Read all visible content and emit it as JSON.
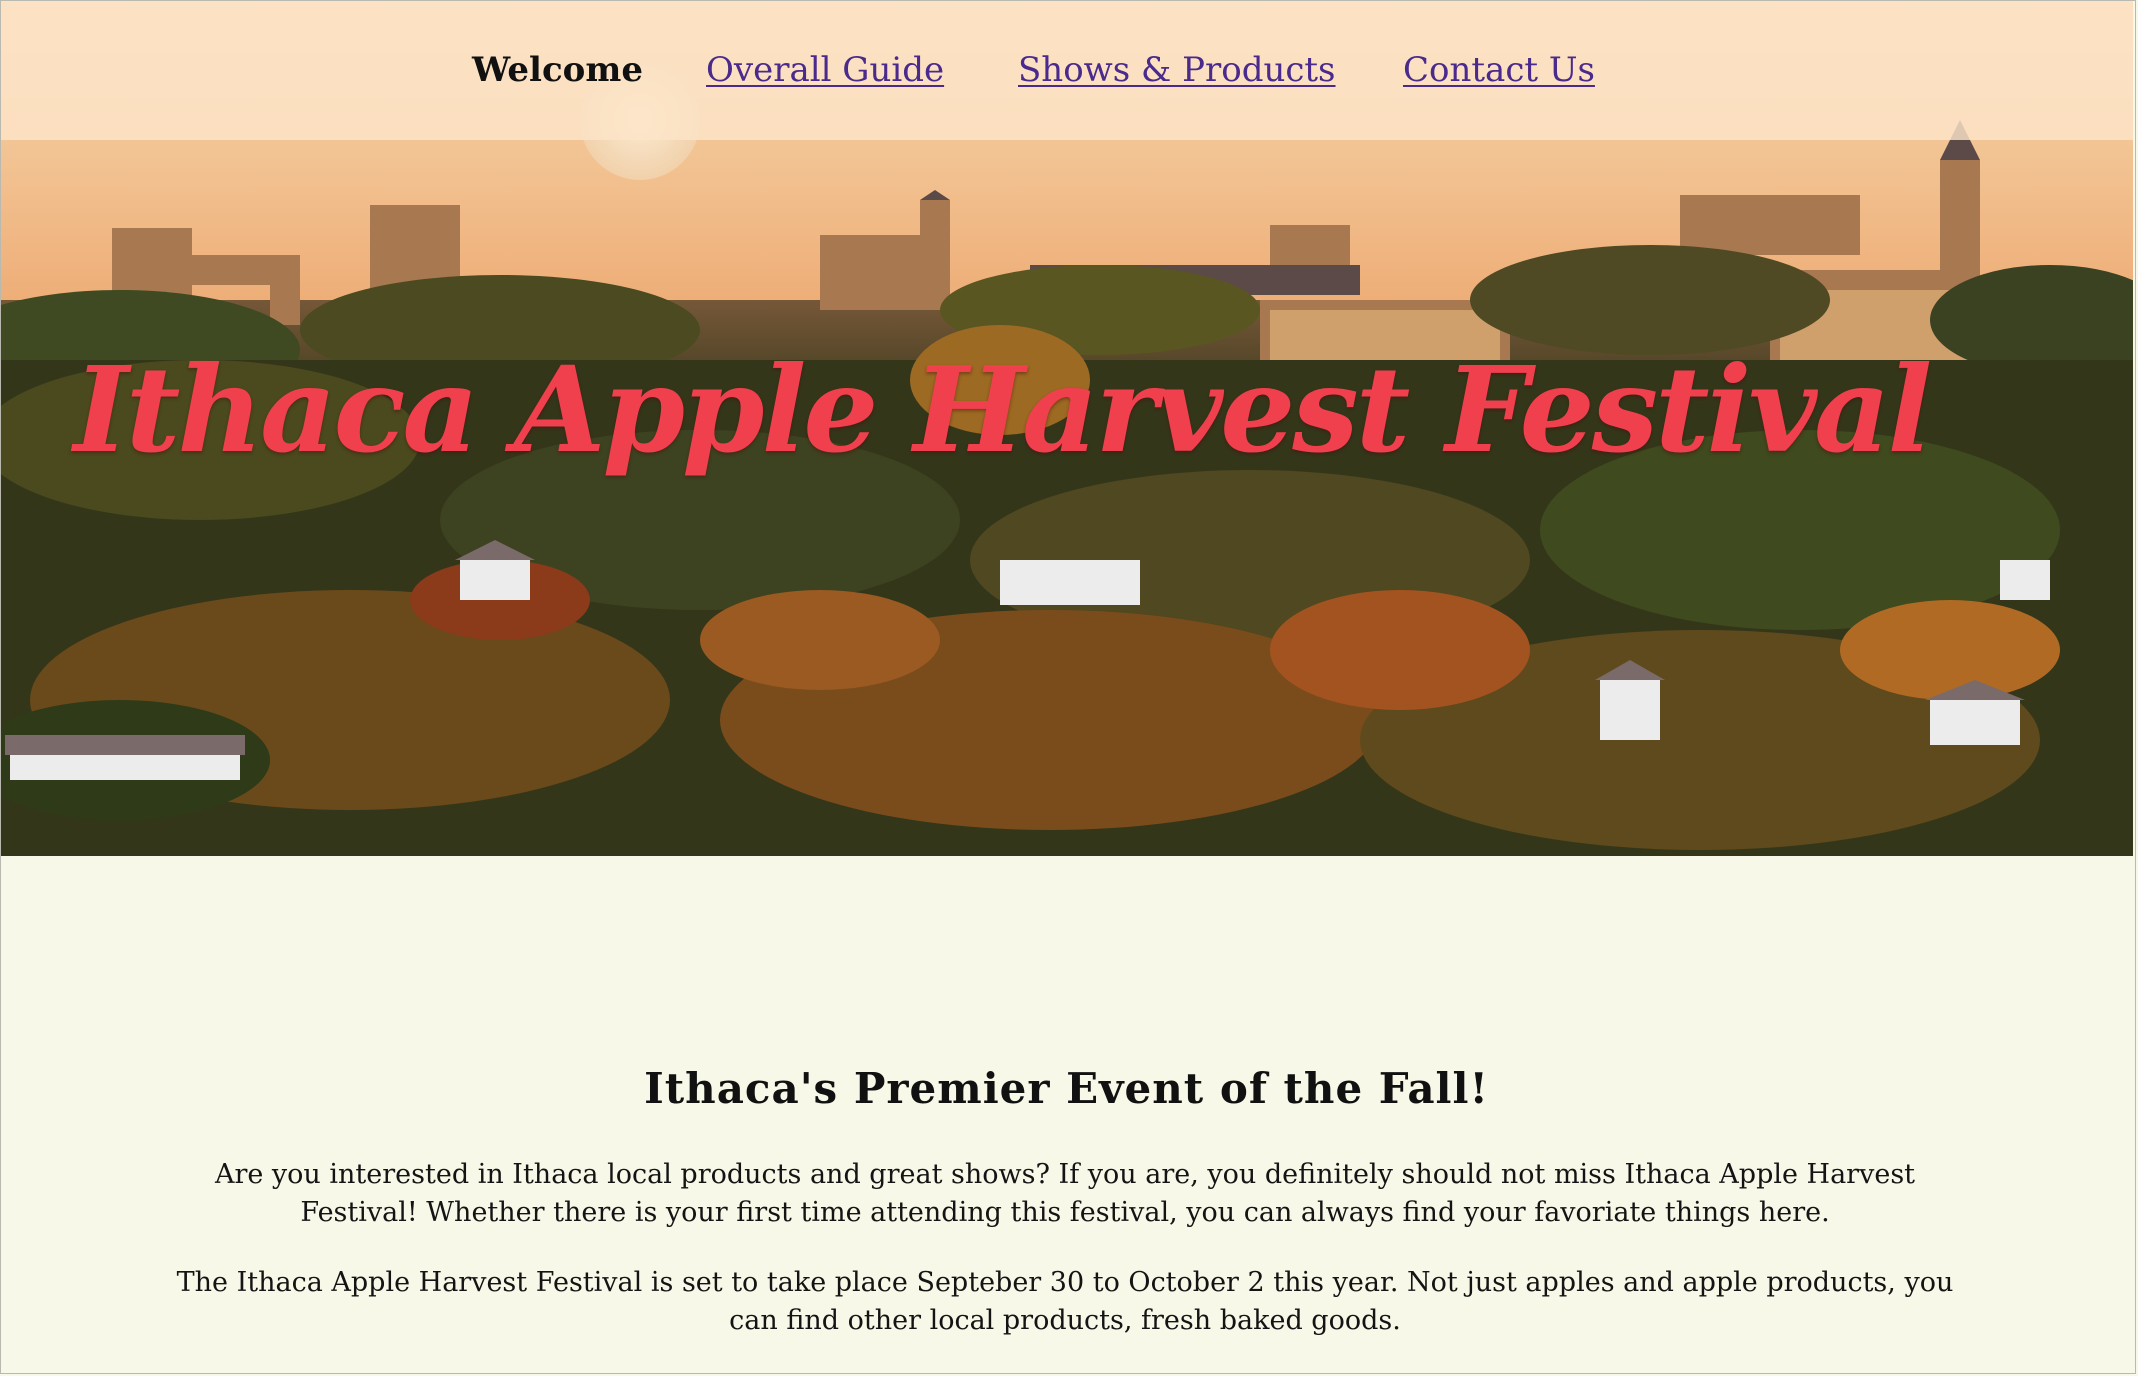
{
  "nav": {
    "items": [
      {
        "label": "Welcome",
        "current": true
      },
      {
        "label": "Overall Guide",
        "current": false
      },
      {
        "label": "Shows & Products",
        "current": false
      },
      {
        "label": "Contact Us",
        "current": false
      }
    ]
  },
  "hero": {
    "title": "Ithaca Apple Harvest Festival",
    "title_color": "#f0404e"
  },
  "main": {
    "headline": "Ithaca's Premier Event of the Fall!",
    "paragraphs": [
      "Are you interested in Ithaca local products and great shows? If you are, you definitely should not miss Ithaca Apple Harvest Festival! Whether there is your first time attending this festival, you can always find your favoriate things here.",
      "The Ithaca Apple Harvest Festival is set to take place Septeber 30 to October 2 this year. Not just apples and apple products, you can find other local products, fresh baked goods."
    ]
  },
  "colors": {
    "background": "#f8f8e8",
    "nav_background": "#fde4c8",
    "link": "#4a2a8c"
  }
}
